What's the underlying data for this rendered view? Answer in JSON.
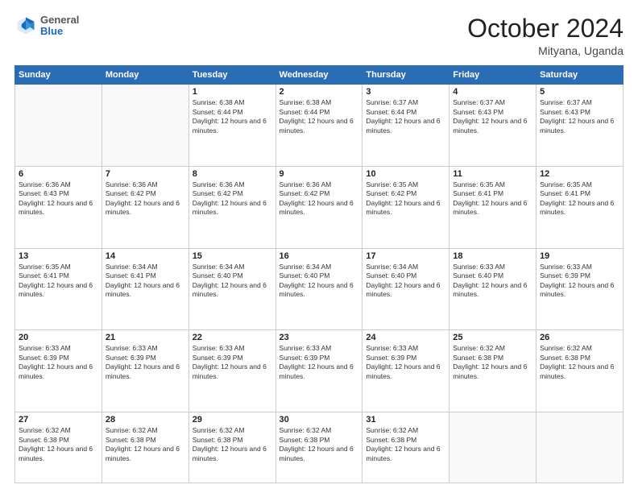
{
  "logo": {
    "general": "General",
    "blue": "Blue"
  },
  "header": {
    "month": "October 2024",
    "location": "Mityana, Uganda"
  },
  "days_of_week": [
    "Sunday",
    "Monday",
    "Tuesday",
    "Wednesday",
    "Thursday",
    "Friday",
    "Saturday"
  ],
  "weeks": [
    [
      {
        "day": "",
        "empty": true
      },
      {
        "day": "",
        "empty": true
      },
      {
        "day": "1",
        "sunrise": "6:38 AM",
        "sunset": "6:44 PM",
        "daylight": "12 hours and 6 minutes."
      },
      {
        "day": "2",
        "sunrise": "6:38 AM",
        "sunset": "6:44 PM",
        "daylight": "12 hours and 6 minutes."
      },
      {
        "day": "3",
        "sunrise": "6:37 AM",
        "sunset": "6:44 PM",
        "daylight": "12 hours and 6 minutes."
      },
      {
        "day": "4",
        "sunrise": "6:37 AM",
        "sunset": "6:43 PM",
        "daylight": "12 hours and 6 minutes."
      },
      {
        "day": "5",
        "sunrise": "6:37 AM",
        "sunset": "6:43 PM",
        "daylight": "12 hours and 6 minutes."
      }
    ],
    [
      {
        "day": "6",
        "sunrise": "6:36 AM",
        "sunset": "6:43 PM",
        "daylight": "12 hours and 6 minutes."
      },
      {
        "day": "7",
        "sunrise": "6:36 AM",
        "sunset": "6:42 PM",
        "daylight": "12 hours and 6 minutes."
      },
      {
        "day": "8",
        "sunrise": "6:36 AM",
        "sunset": "6:42 PM",
        "daylight": "12 hours and 6 minutes."
      },
      {
        "day": "9",
        "sunrise": "6:36 AM",
        "sunset": "6:42 PM",
        "daylight": "12 hours and 6 minutes."
      },
      {
        "day": "10",
        "sunrise": "6:35 AM",
        "sunset": "6:42 PM",
        "daylight": "12 hours and 6 minutes."
      },
      {
        "day": "11",
        "sunrise": "6:35 AM",
        "sunset": "6:41 PM",
        "daylight": "12 hours and 6 minutes."
      },
      {
        "day": "12",
        "sunrise": "6:35 AM",
        "sunset": "6:41 PM",
        "daylight": "12 hours and 6 minutes."
      }
    ],
    [
      {
        "day": "13",
        "sunrise": "6:35 AM",
        "sunset": "6:41 PM",
        "daylight": "12 hours and 6 minutes."
      },
      {
        "day": "14",
        "sunrise": "6:34 AM",
        "sunset": "6:41 PM",
        "daylight": "12 hours and 6 minutes."
      },
      {
        "day": "15",
        "sunrise": "6:34 AM",
        "sunset": "6:40 PM",
        "daylight": "12 hours and 6 minutes."
      },
      {
        "day": "16",
        "sunrise": "6:34 AM",
        "sunset": "6:40 PM",
        "daylight": "12 hours and 6 minutes."
      },
      {
        "day": "17",
        "sunrise": "6:34 AM",
        "sunset": "6:40 PM",
        "daylight": "12 hours and 6 minutes."
      },
      {
        "day": "18",
        "sunrise": "6:33 AM",
        "sunset": "6:40 PM",
        "daylight": "12 hours and 6 minutes."
      },
      {
        "day": "19",
        "sunrise": "6:33 AM",
        "sunset": "6:39 PM",
        "daylight": "12 hours and 6 minutes."
      }
    ],
    [
      {
        "day": "20",
        "sunrise": "6:33 AM",
        "sunset": "6:39 PM",
        "daylight": "12 hours and 6 minutes."
      },
      {
        "day": "21",
        "sunrise": "6:33 AM",
        "sunset": "6:39 PM",
        "daylight": "12 hours and 6 minutes."
      },
      {
        "day": "22",
        "sunrise": "6:33 AM",
        "sunset": "6:39 PM",
        "daylight": "12 hours and 6 minutes."
      },
      {
        "day": "23",
        "sunrise": "6:33 AM",
        "sunset": "6:39 PM",
        "daylight": "12 hours and 6 minutes."
      },
      {
        "day": "24",
        "sunrise": "6:33 AM",
        "sunset": "6:39 PM",
        "daylight": "12 hours and 6 minutes."
      },
      {
        "day": "25",
        "sunrise": "6:32 AM",
        "sunset": "6:38 PM",
        "daylight": "12 hours and 6 minutes."
      },
      {
        "day": "26",
        "sunrise": "6:32 AM",
        "sunset": "6:38 PM",
        "daylight": "12 hours and 6 minutes."
      }
    ],
    [
      {
        "day": "27",
        "sunrise": "6:32 AM",
        "sunset": "6:38 PM",
        "daylight": "12 hours and 6 minutes."
      },
      {
        "day": "28",
        "sunrise": "6:32 AM",
        "sunset": "6:38 PM",
        "daylight": "12 hours and 6 minutes."
      },
      {
        "day": "29",
        "sunrise": "6:32 AM",
        "sunset": "6:38 PM",
        "daylight": "12 hours and 6 minutes."
      },
      {
        "day": "30",
        "sunrise": "6:32 AM",
        "sunset": "6:38 PM",
        "daylight": "12 hours and 6 minutes."
      },
      {
        "day": "31",
        "sunrise": "6:32 AM",
        "sunset": "6:38 PM",
        "daylight": "12 hours and 6 minutes."
      },
      {
        "day": "",
        "empty": true
      },
      {
        "day": "",
        "empty": true
      }
    ]
  ]
}
